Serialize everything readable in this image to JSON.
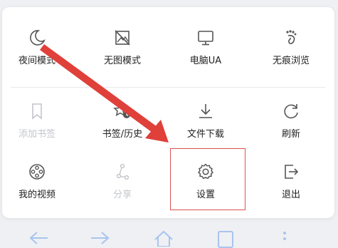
{
  "menu": {
    "row1": [
      {
        "label": "夜间模式",
        "icon": "moon-icon"
      },
      {
        "label": "无图模式",
        "icon": "no-image-icon"
      },
      {
        "label": "电脑UA",
        "icon": "monitor-icon"
      },
      {
        "label": "无痕浏览",
        "icon": "footprint-icon"
      }
    ],
    "row2": [
      {
        "label": "添加书签",
        "icon": "bookmark-icon",
        "disabled": true
      },
      {
        "label": "书签/历史",
        "icon": "star-clock-icon"
      },
      {
        "label": "文件下载",
        "icon": "download-icon"
      },
      {
        "label": "刷新",
        "icon": "refresh-icon"
      }
    ],
    "row3": [
      {
        "label": "我的视频",
        "icon": "film-reel-icon"
      },
      {
        "label": "分享",
        "icon": "share-icon",
        "disabled": true
      },
      {
        "label": "设置",
        "icon": "gear-icon"
      },
      {
        "label": "退出",
        "icon": "exit-icon"
      }
    ]
  },
  "annotation": {
    "color": "#e0403a",
    "target": "设置"
  },
  "colors": {
    "accent": "#3d7be5",
    "icon": "#555555",
    "disabled": "#c3c6cb",
    "nav": "#a9c4ee"
  }
}
